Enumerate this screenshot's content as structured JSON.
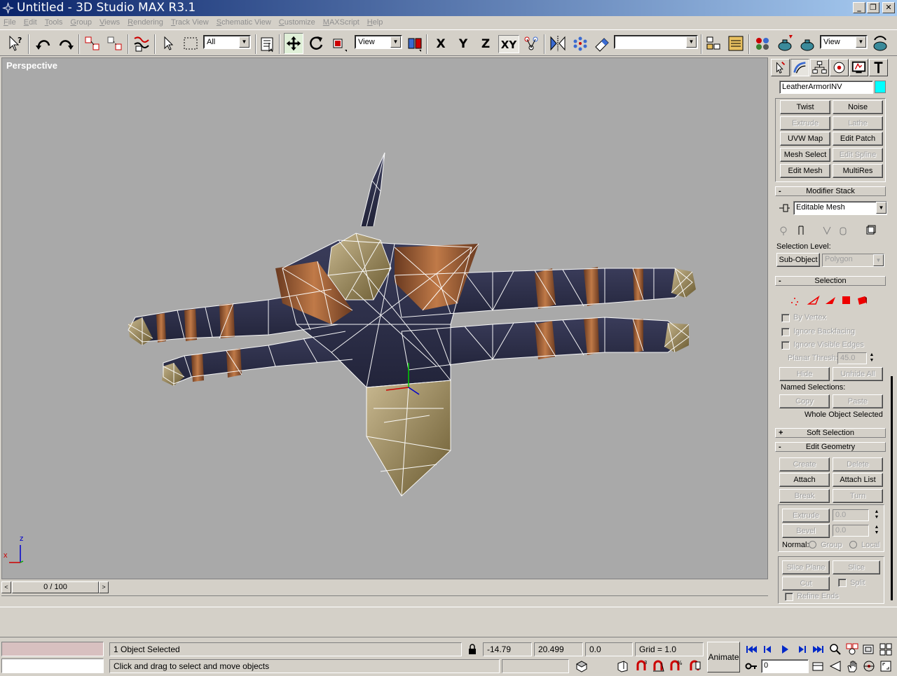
{
  "window": {
    "title": "Untitled - 3D Studio MAX R3.1",
    "minimize": "_",
    "restore": "❐",
    "close": "✕"
  },
  "menu": [
    "File",
    "Edit",
    "Tools",
    "Group",
    "Views",
    "Rendering",
    "Track View",
    "Schematic View",
    "Customize",
    "MAXScript",
    "Help"
  ],
  "toolbar": {
    "selection_filter": "All",
    "ref_coord": "View",
    "axis_x": "X",
    "axis_y": "Y",
    "axis_z": "Z",
    "axis_xy": "XY",
    "named_selection": "",
    "render_view": "View"
  },
  "viewport": {
    "label": "Perspective",
    "axis_z": "z",
    "axis_x": "x"
  },
  "timeslider": {
    "position": "0 / 100",
    "prev": "<",
    "next": ">"
  },
  "command_panel": {
    "object_name": "LeatherArmorINV",
    "object_color": "#00ffff",
    "modifier_buttons": [
      {
        "label": "Twist",
        "enabled": true
      },
      {
        "label": "Noise",
        "enabled": true
      },
      {
        "label": "Extrude",
        "enabled": false
      },
      {
        "label": "Lathe",
        "enabled": false
      },
      {
        "label": "UVW Map",
        "enabled": true
      },
      {
        "label": "Edit Patch",
        "enabled": true
      },
      {
        "label": "Mesh Select",
        "enabled": true
      },
      {
        "label": "Edit Spline",
        "enabled": false
      },
      {
        "label": "Edit Mesh",
        "enabled": true
      },
      {
        "label": "MultiRes",
        "enabled": true
      }
    ],
    "modifier_stack_title": "Modifier Stack",
    "modifier_stack_value": "Editable Mesh",
    "selection_level_label": "Selection Level:",
    "sub_object": "Sub-Object",
    "sub_object_level": "Polygon",
    "selection_title": "Selection",
    "by_vertex": "By Vertex",
    "ignore_backfacing": "Ignore Backfacing",
    "ignore_visible_edges": "Ignore Visible Edges",
    "planar_thresh_label": "Planar Thresh:",
    "planar_thresh_value": "45.0",
    "hide": "Hide",
    "unhide_all": "Unhide All",
    "named_selections_label": "Named Selections:",
    "copy": "Copy",
    "paste": "Paste",
    "selection_status": "Whole Object Selected",
    "soft_selection_title": "Soft Selection",
    "edit_geometry_title": "Edit Geometry",
    "create": "Create",
    "delete": "Delete",
    "attach": "Attach",
    "attach_list": "Attach List",
    "break": "Break",
    "turn": "Turn",
    "extrude": "Extrude",
    "extrude_value": "0.0",
    "bevel": "Bevel",
    "bevel_value": "0.0",
    "normal_label": "Normal:",
    "normal_group": "Group",
    "normal_local": "Local",
    "slice_plane": "Slice Plane",
    "slice": "Slice",
    "cut": "Cut",
    "split": "Split",
    "refine_ends": "Refine Ends",
    "minus": "-",
    "plus": "+"
  },
  "status": {
    "selected": "1 Object Selected",
    "x": "-14.79",
    "y": "20.499",
    "z": "0.0",
    "grid": "Grid = 1.0",
    "prompt": "Click and drag to select and move objects",
    "animate": "Animate",
    "frame": "0"
  }
}
